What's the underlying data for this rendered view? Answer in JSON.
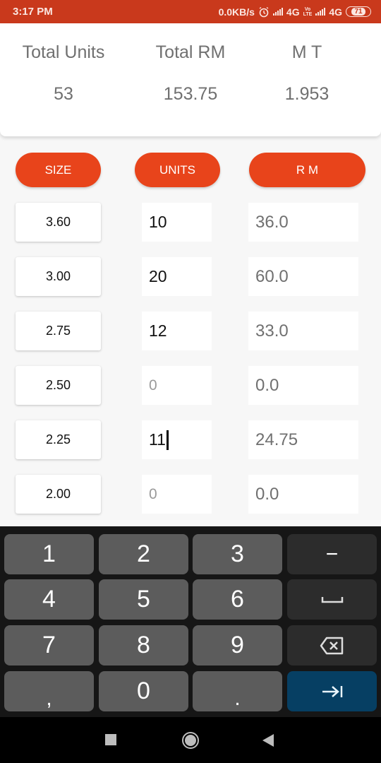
{
  "status_bar": {
    "time": "3:17 PM",
    "net_speed": "0.0KB/s",
    "alarm_icon": "alarm-icon",
    "sim1_network": "4G",
    "volte_top": "Vo",
    "volte_bottom": "LTE",
    "sim2_network": "4G",
    "battery": "71"
  },
  "summary": {
    "columns": [
      {
        "label": "Total Units",
        "value": "53"
      },
      {
        "label": "Total RM",
        "value": "153.75"
      },
      {
        "label": "M T",
        "value": "1.953"
      }
    ]
  },
  "headers": {
    "size": "SIZE",
    "units": "UNITS",
    "rm": "R M"
  },
  "colors": {
    "accent": "#e8441b",
    "status_bar": "#c9391c",
    "keyboard_action": "#063f63"
  },
  "rows": [
    {
      "size": "3.60",
      "units": "10",
      "units_placeholder": false,
      "rm": "36.0"
    },
    {
      "size": "3.00",
      "units": "20",
      "units_placeholder": false,
      "rm": "60.0"
    },
    {
      "size": "2.75",
      "units": "12",
      "units_placeholder": false,
      "rm": "33.0"
    },
    {
      "size": "2.50",
      "units": "0",
      "units_placeholder": true,
      "rm": "0.0"
    },
    {
      "size": "2.25",
      "units": "11",
      "units_placeholder": false,
      "focused": true,
      "rm": "24.75"
    },
    {
      "size": "2.00",
      "units": "0",
      "units_placeholder": true,
      "rm": "0.0"
    }
  ],
  "keyboard": {
    "keys": [
      [
        "1",
        "2",
        "3",
        "−"
      ],
      [
        "4",
        "5",
        "6",
        "space"
      ],
      [
        "7",
        "8",
        "9",
        "backspace"
      ],
      [
        ",",
        "0",
        ".",
        "next"
      ]
    ]
  },
  "nav_bar": {
    "recents": "recents-icon",
    "home": "home-icon",
    "back": "back-icon"
  }
}
